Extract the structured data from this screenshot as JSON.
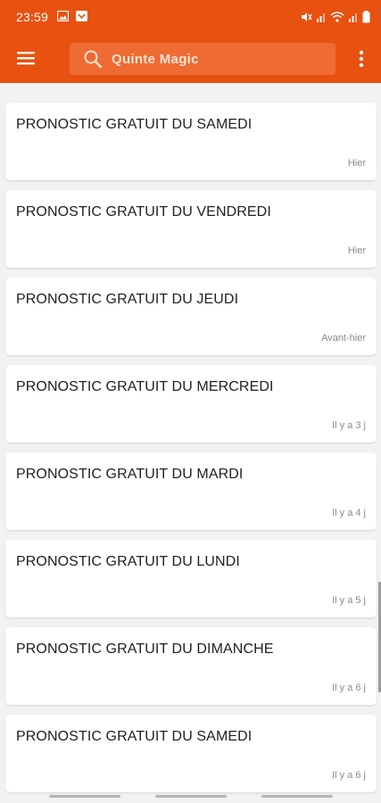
{
  "status_bar": {
    "time": "23:59",
    "icons": [
      "image-icon",
      "app-notification-icon",
      "mute-icon",
      "signal-icon",
      "wifi-icon",
      "signal-2-icon",
      "battery-icon"
    ]
  },
  "app_bar": {
    "menu_icon": "menu-icon",
    "search_placeholder": "Quinte Magic",
    "more_icon": "more-vert-icon",
    "color": "#e8510f"
  },
  "articles": [
    {
      "title": "PRONOSTIC GRATUIT DU SAMEDI",
      "time": "Hier"
    },
    {
      "title": "PRONOSTIC GRATUIT DU VENDREDI",
      "time": "Hier"
    },
    {
      "title": "PRONOSTIC GRATUIT DU JEUDI",
      "time": "Avant-hier"
    },
    {
      "title": "PRONOSTIC GRATUIT DU MERCREDI",
      "time": "Il y a 3 j"
    },
    {
      "title": "PRONOSTIC GRATUIT DU MARDI",
      "time": "Il y a 4 j"
    },
    {
      "title": "PRONOSTIC GRATUIT DU LUNDI",
      "time": "Il y a 5 j"
    },
    {
      "title": "PRONOSTIC GRATUIT DU DIMANCHE",
      "time": "Il y a 6 j"
    },
    {
      "title": "PRONOSTIC GRATUIT DU SAMEDI",
      "time": "Il y a 6 j"
    }
  ]
}
